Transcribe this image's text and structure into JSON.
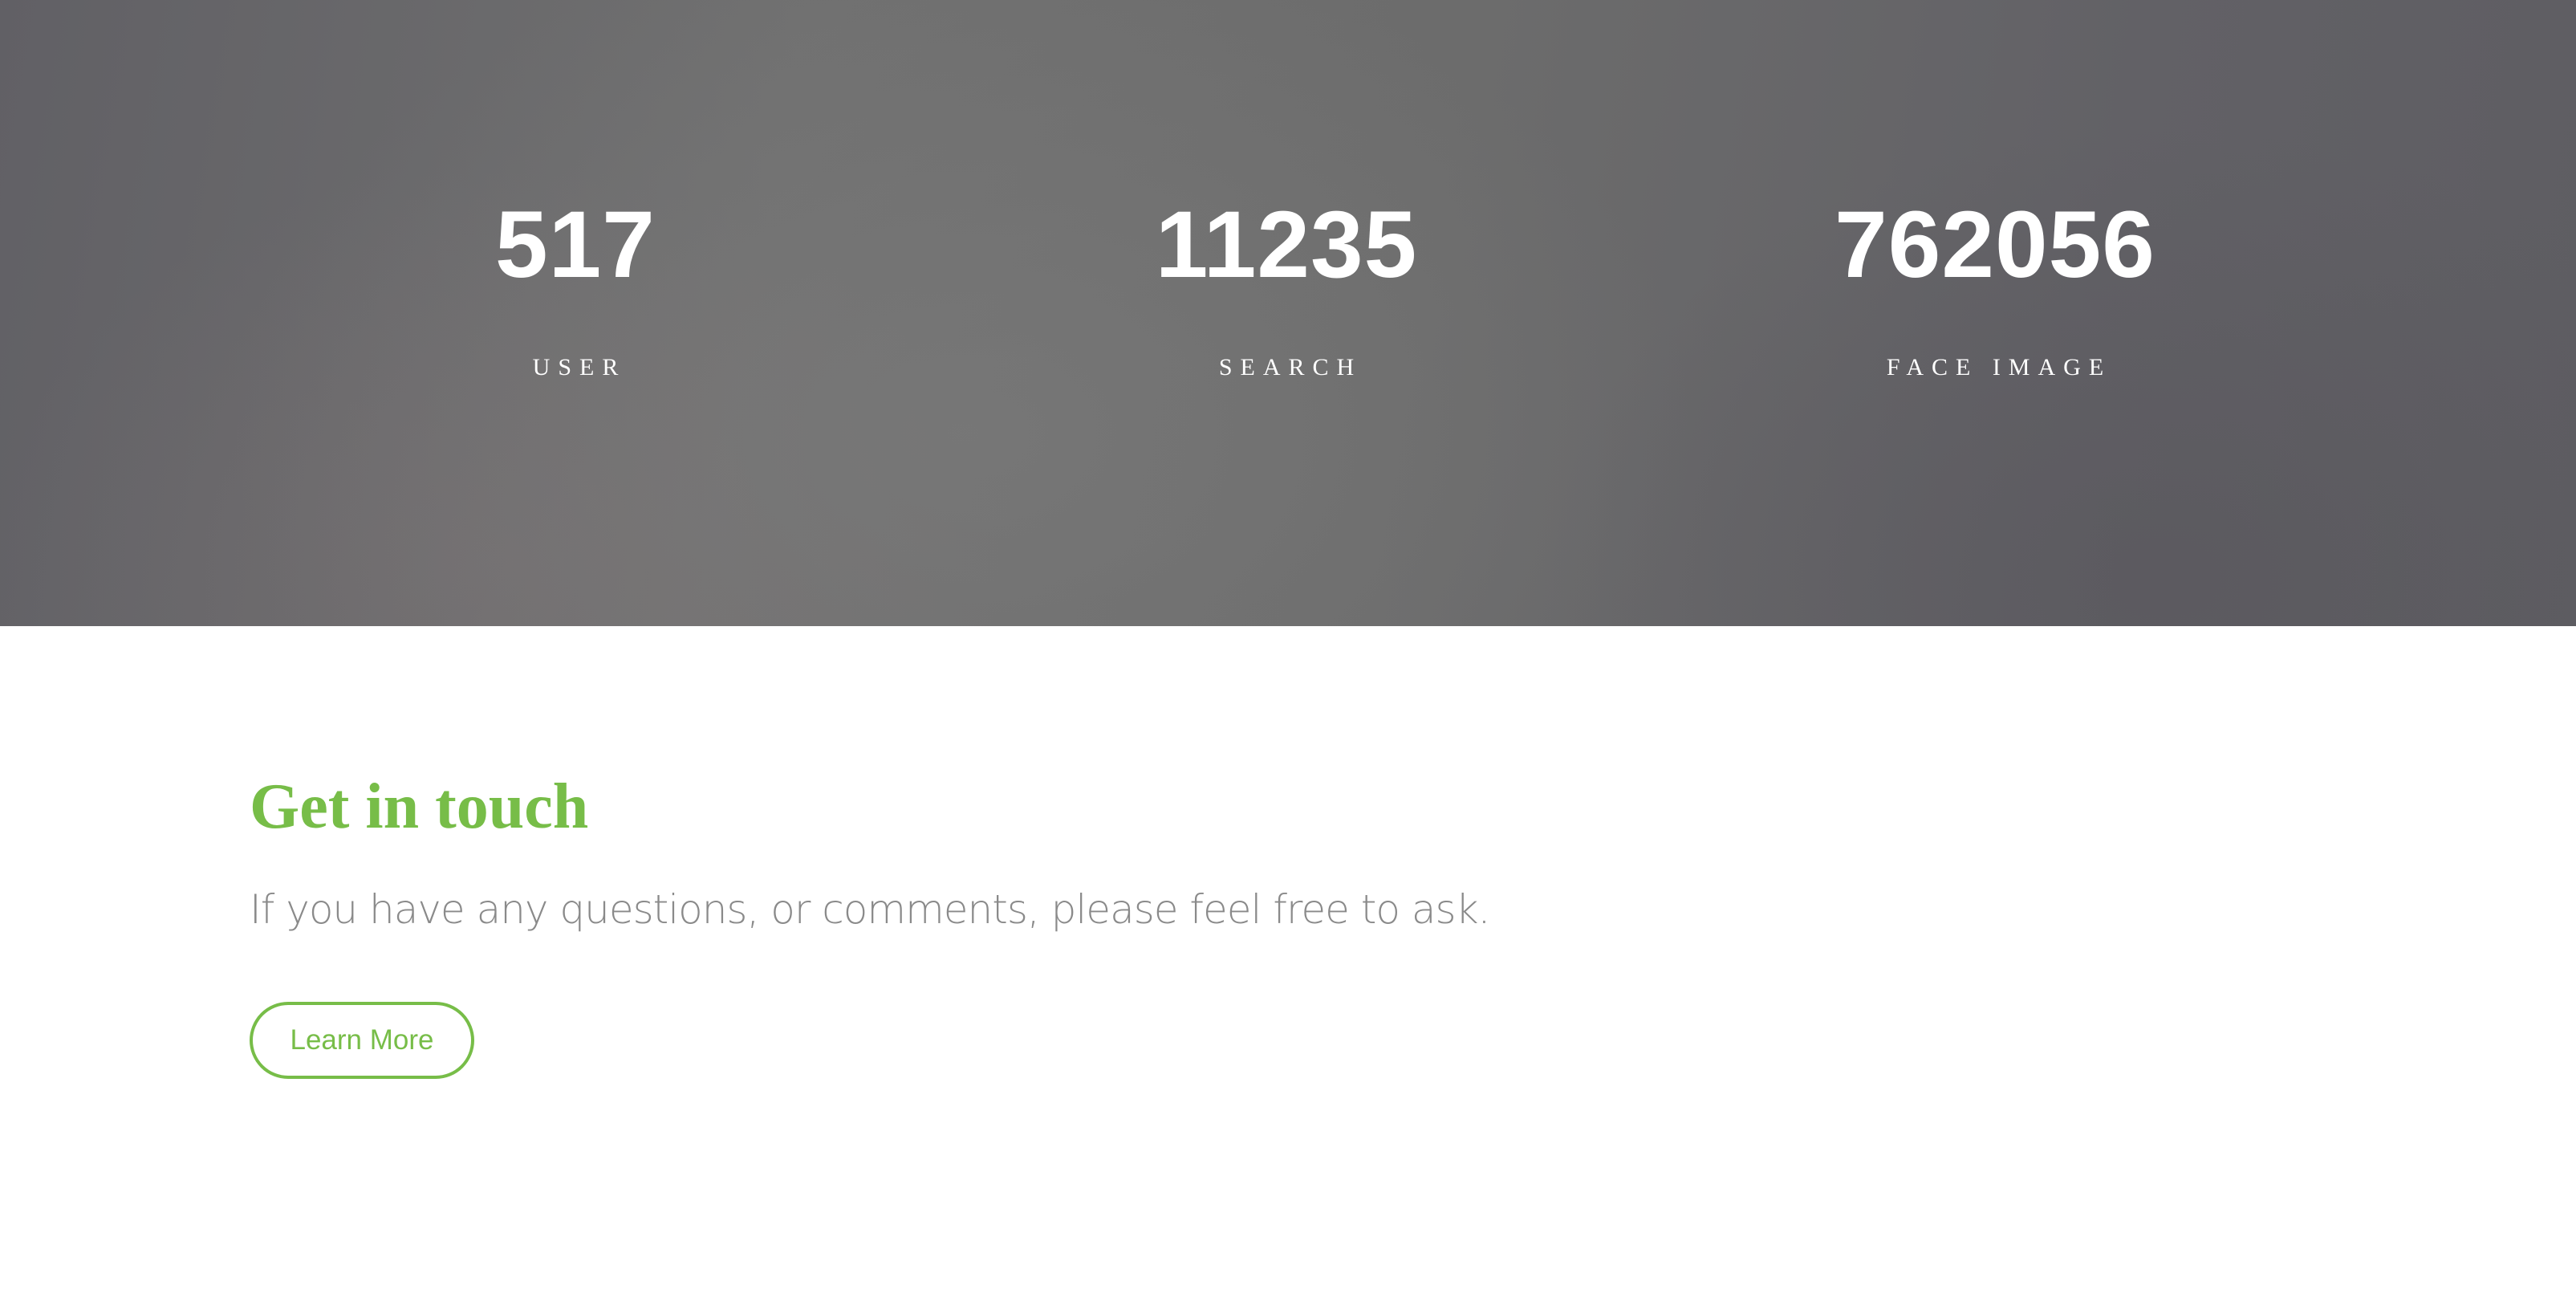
{
  "stats": [
    {
      "number": "517",
      "label": "USER"
    },
    {
      "number": "11235",
      "label": "SEARCH"
    },
    {
      "number": "762056",
      "label": "FACE IMAGE"
    }
  ],
  "contact": {
    "title": "Get in touch",
    "text": "If you have any questions, or comments, please feel free to ask.",
    "button_label": "Learn More"
  },
  "colors": {
    "accent": "#77bd48",
    "body_text": "#8a8a8a",
    "band_background": "#6a6a6c"
  }
}
